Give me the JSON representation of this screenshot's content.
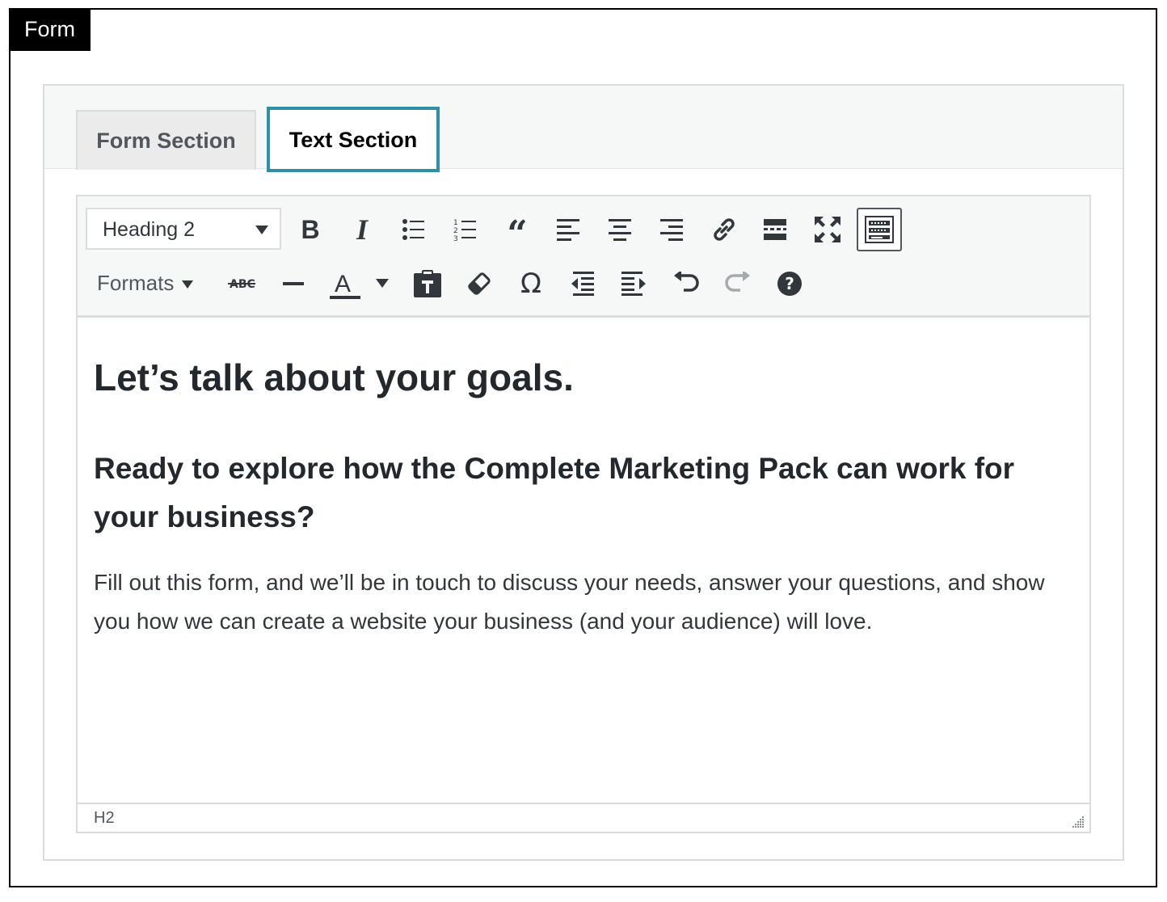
{
  "frame": {
    "label": "Form"
  },
  "tabs": [
    {
      "label": "Form Section",
      "active": false
    },
    {
      "label": "Text Section",
      "active": true
    }
  ],
  "toolbar": {
    "block_format": "Heading 2",
    "formats_label": "Formats",
    "row1_icons": [
      "bold-icon",
      "italic-icon",
      "bullet-list-icon",
      "numbered-list-icon",
      "blockquote-icon",
      "align-left-icon",
      "align-center-icon",
      "align-right-icon",
      "link-icon",
      "read-more-icon",
      "fullscreen-icon",
      "toolbar-toggle-icon"
    ],
    "row2_icons": [
      "strikethrough-icon",
      "horizontal-rule-icon",
      "text-color-icon",
      "paste-text-icon",
      "clear-formatting-icon",
      "special-character-icon",
      "outdent-icon",
      "indent-icon",
      "undo-icon",
      "redo-icon",
      "help-icon"
    ]
  },
  "content": {
    "heading": "Let’s talk about your goals.",
    "subheading": "Ready to explore how the Complete Marketing Pack can work for your business?",
    "paragraph": "Fill out this form, and we’ll be in touch to discuss your needs, answer your questions, and show you how we can create a website your business (and your audience) will love."
  },
  "statusbar": {
    "path": "H2"
  },
  "colors": {
    "active_tab_border": "#2f8fab",
    "toolbar_bg": "#f6f7f7"
  }
}
